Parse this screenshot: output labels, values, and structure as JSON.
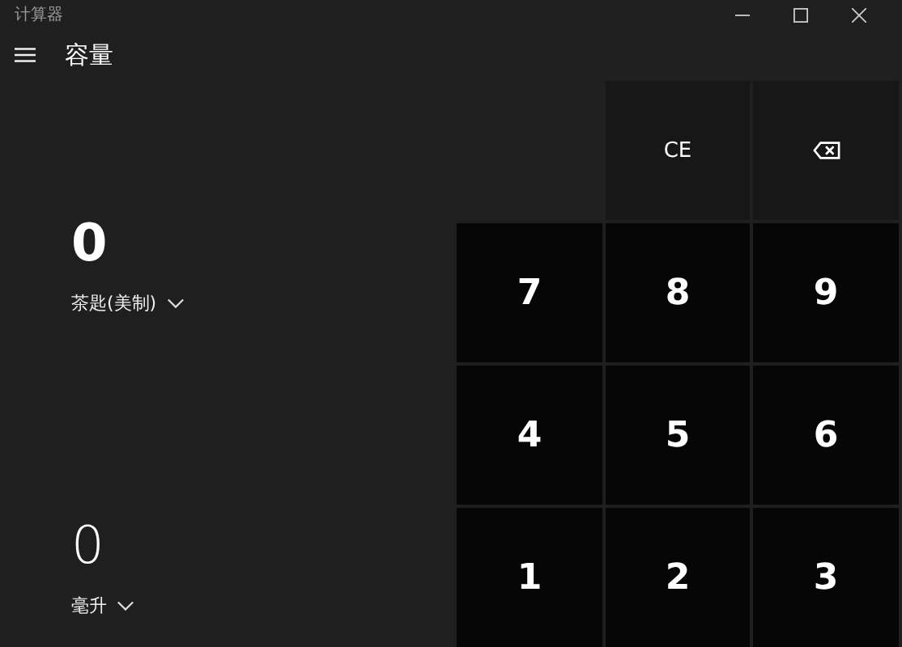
{
  "window": {
    "title": "计算器"
  },
  "header": {
    "title": "容量"
  },
  "units": [
    {
      "value": "0",
      "unit": "茶匙(美制)",
      "selected": true
    },
    {
      "value": "0",
      "unit": "毫升",
      "selected": false
    }
  ],
  "keys": [
    {
      "kind": "blank"
    },
    {
      "kind": "function",
      "label": "CE"
    },
    {
      "kind": "backspace"
    },
    {
      "kind": "digit",
      "label": "7"
    },
    {
      "kind": "digit",
      "label": "8"
    },
    {
      "kind": "digit",
      "label": "9"
    },
    {
      "kind": "digit",
      "label": "4"
    },
    {
      "kind": "digit",
      "label": "5"
    },
    {
      "kind": "digit",
      "label": "6"
    },
    {
      "kind": "digit",
      "label": "1"
    },
    {
      "kind": "digit",
      "label": "2"
    },
    {
      "kind": "digit",
      "label": "3"
    }
  ]
}
